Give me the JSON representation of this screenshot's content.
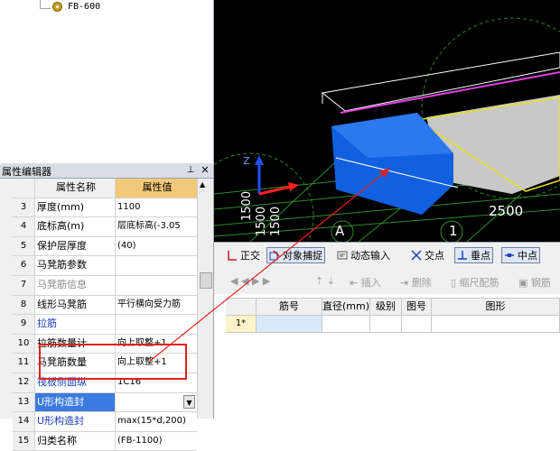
{
  "tree": {
    "node_label": "FB-600"
  },
  "property_editor": {
    "title": "属性编辑器",
    "pin": "⊥",
    "close": "✕",
    "columns": [
      "属性名称",
      "属性值"
    ],
    "rows": [
      {
        "num": "3",
        "name": "厚度(mm)",
        "value": "1100",
        "style": "normal"
      },
      {
        "num": "4",
        "name": "底标高(m)",
        "value": "层底标高(-3.05",
        "style": "normal"
      },
      {
        "num": "5",
        "name": "保护层厚度",
        "value": "(40)",
        "style": "normal"
      },
      {
        "num": "6",
        "name": "马凳筋参数",
        "value": "",
        "style": "normal"
      },
      {
        "num": "7",
        "name": "马凳筋信息",
        "value": "",
        "style": "gray"
      },
      {
        "num": "8",
        "name": "线形马凳筋",
        "value": "平行横向受力筋",
        "style": "normal"
      },
      {
        "num": "9",
        "name": "拉筋",
        "value": "",
        "style": "blue"
      },
      {
        "num": "10",
        "name": "拉筋数量计",
        "value": "向上取整+1",
        "style": "normal"
      },
      {
        "num": "11",
        "name": "马凳筋数量",
        "value": "向上取整+1",
        "style": "normal"
      },
      {
        "num": "12",
        "name": "筏板侧面纵",
        "value": "1C16",
        "style": "blue"
      },
      {
        "num": "13",
        "name": "U形构造封",
        "value": "",
        "style": "selected"
      },
      {
        "num": "14",
        "name": "U形构造封",
        "value": "max(15*d,200)",
        "style": "blue"
      },
      {
        "num": "15",
        "name": "归类名称",
        "value": "(FB-1100)",
        "style": "normal"
      }
    ]
  },
  "view3d": {
    "axis_a": "A",
    "axis_1": "1",
    "dim_2500": "2500",
    "dim_1500": "1500",
    "axis_z": "Z"
  },
  "toolbar": {
    "ortho": "正交",
    "snap": "对象捕捉",
    "dynamic_input": "动态输入",
    "intersection": "交点",
    "perpendicular": "垂点",
    "midpoint": "中点"
  },
  "toolbar2": {
    "insert": "插入",
    "delete": "删除",
    "scale_rebar": "缩尺配筋",
    "rebar": "钢筋"
  },
  "rebar_table": {
    "headers": [
      "",
      "筋号",
      "直径(mm)",
      "级别",
      "图号",
      "图形"
    ],
    "row_marker": "1*"
  },
  "colors": {
    "accent_red": "#e0201a",
    "selection_blue": "#3c7be0",
    "header_orange": "#f2c97a",
    "slab_blue": "#1060e0"
  }
}
